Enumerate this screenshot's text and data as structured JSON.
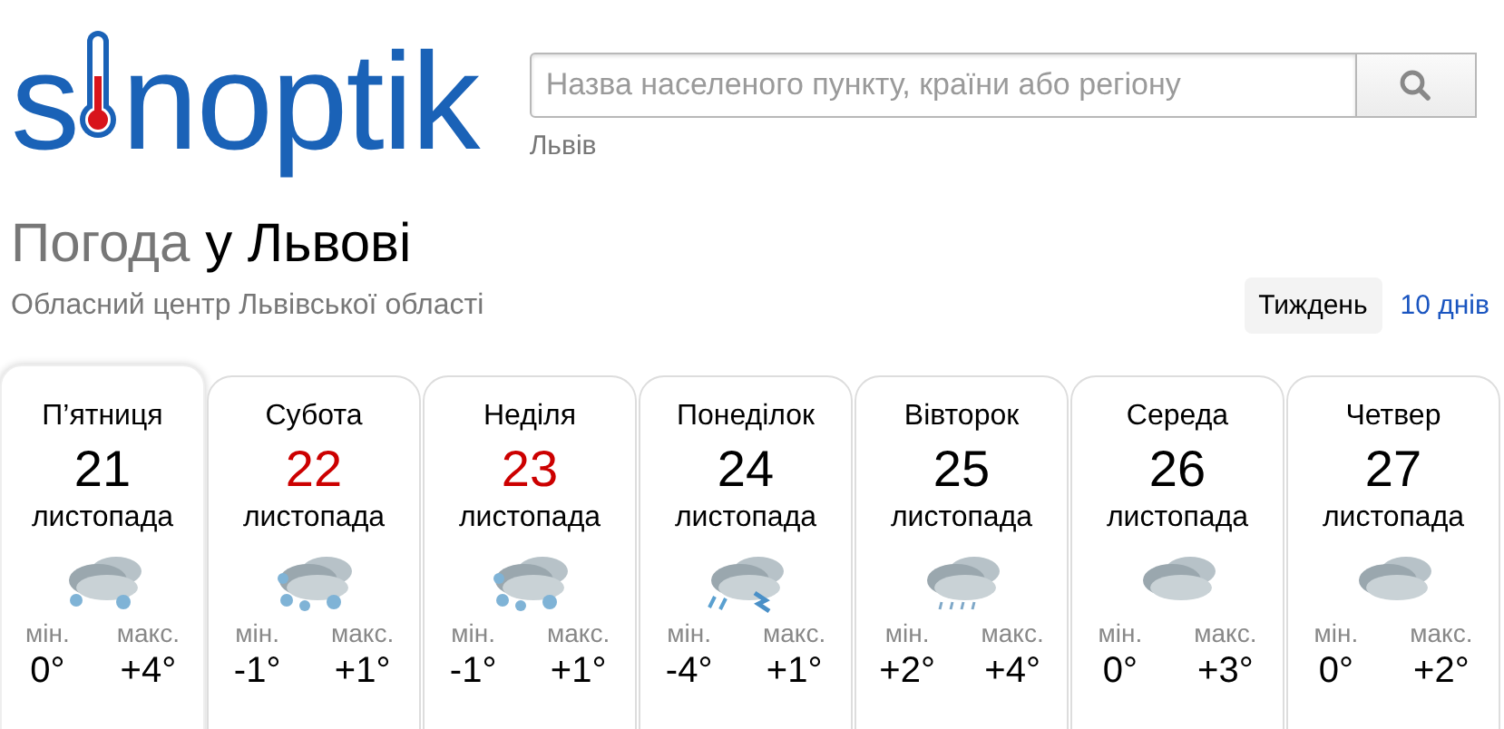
{
  "logo": {
    "before": "s",
    "after": "noptik"
  },
  "search": {
    "placeholder": "Назва населеного пункту, країни або регіону",
    "recent": "Львів"
  },
  "title": {
    "lead": "Погода",
    "place": "у Львові"
  },
  "subtitle": "Обласний центр Львівської області",
  "tabs": [
    {
      "label": "Тиждень",
      "selected": true
    },
    {
      "label": "10 днів",
      "selected": false
    }
  ],
  "days": [
    {
      "weekday": "П’ятниця",
      "date": "21",
      "month": "листопада",
      "weekend": false,
      "selected": true,
      "kind": "snow",
      "min_label": "мін.",
      "min": "0°",
      "max_label": "макс.",
      "max": "+4°"
    },
    {
      "weekday": "Субота",
      "date": "22",
      "month": "листопада",
      "weekend": true,
      "selected": false,
      "kind": "heavy-snow",
      "min_label": "мін.",
      "min": "-1°",
      "max_label": "макс.",
      "max": "+1°"
    },
    {
      "weekday": "Неділя",
      "date": "23",
      "month": "листопада",
      "weekend": true,
      "selected": false,
      "kind": "heavy-snow",
      "min_label": "мін.",
      "min": "-1°",
      "max_label": "макс.",
      "max": "+1°"
    },
    {
      "weekday": "Понеділок",
      "date": "24",
      "month": "листопада",
      "weekend": false,
      "selected": false,
      "kind": "storm",
      "min_label": "мін.",
      "min": "-4°",
      "max_label": "макс.",
      "max": "+1°"
    },
    {
      "weekday": "Вівторок",
      "date": "25",
      "month": "листопада",
      "weekend": false,
      "selected": false,
      "kind": "rain",
      "min_label": "мін.",
      "min": "+2°",
      "max_label": "макс.",
      "max": "+4°"
    },
    {
      "weekday": "Середа",
      "date": "26",
      "month": "листопада",
      "weekend": false,
      "selected": false,
      "kind": "cloudy",
      "min_label": "мін.",
      "min": "0°",
      "max_label": "макс.",
      "max": "+3°"
    },
    {
      "weekday": "Четвер",
      "date": "27",
      "month": "листопада",
      "weekend": false,
      "selected": false,
      "kind": "cloudy",
      "min_label": "мін.",
      "min": "0°",
      "max_label": "макс.",
      "max": "+2°"
    }
  ]
}
